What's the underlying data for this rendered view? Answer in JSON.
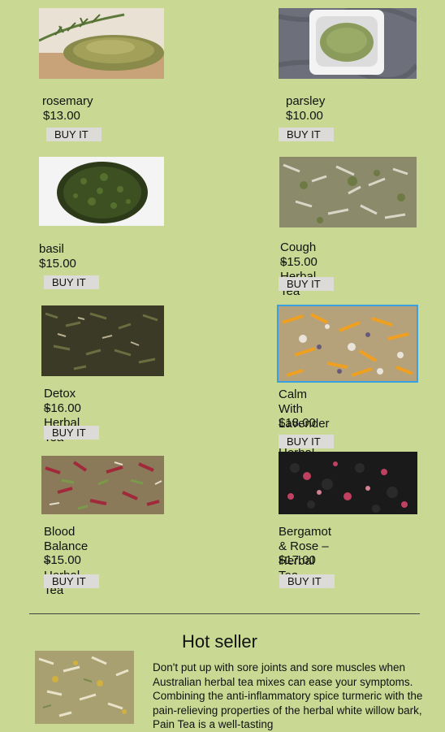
{
  "products": [
    {
      "name": "rosemary",
      "price": "$13.00",
      "buy": "BUY IT",
      "image": "rosemary"
    },
    {
      "name": "parsley",
      "price": "$10.00",
      "buy": "BUY IT",
      "image": "parsley-powder"
    },
    {
      "name": "basil",
      "price": "$15.00",
      "buy": "BUY IT",
      "image": "basil"
    },
    {
      "name": "Cough – Herbal Tea",
      "price": "$15.00",
      "buy": "BUY IT",
      "image": "cough-tea"
    },
    {
      "name": "Detox – Herbal Tea",
      "price": "$16.00",
      "buy": "BUY IT",
      "image": "detox-tea"
    },
    {
      "name": "Calm With Lavender –\nHerbal Tea",
      "price": "$18.00",
      "buy": "BUY IT",
      "image": "calm-tea"
    },
    {
      "name": "Blood Balance –\nHerbal Tea",
      "price": "$15.00",
      "buy": "BUY IT",
      "image": "blood-balance-tea"
    },
    {
      "name": "Bergamot & Rose –\nHerbal Tea",
      "price": "$17.00",
      "buy": "BUY IT",
      "image": "bergamot-rose-tea"
    }
  ],
  "hot_seller": {
    "title": "Hot seller",
    "description": "Don't put up with sore joints and sore muscles when Australian herbal tea mixes can ease your symptoms. Combining the anti-inflammatory spice turmeric with the pain-relieving properties of the herbal white willow bark, Pain Tea is a well-tasting"
  },
  "colors": {
    "background": "#c9d993",
    "button": "#dcdbd8",
    "selection": "#3aa0e0"
  }
}
